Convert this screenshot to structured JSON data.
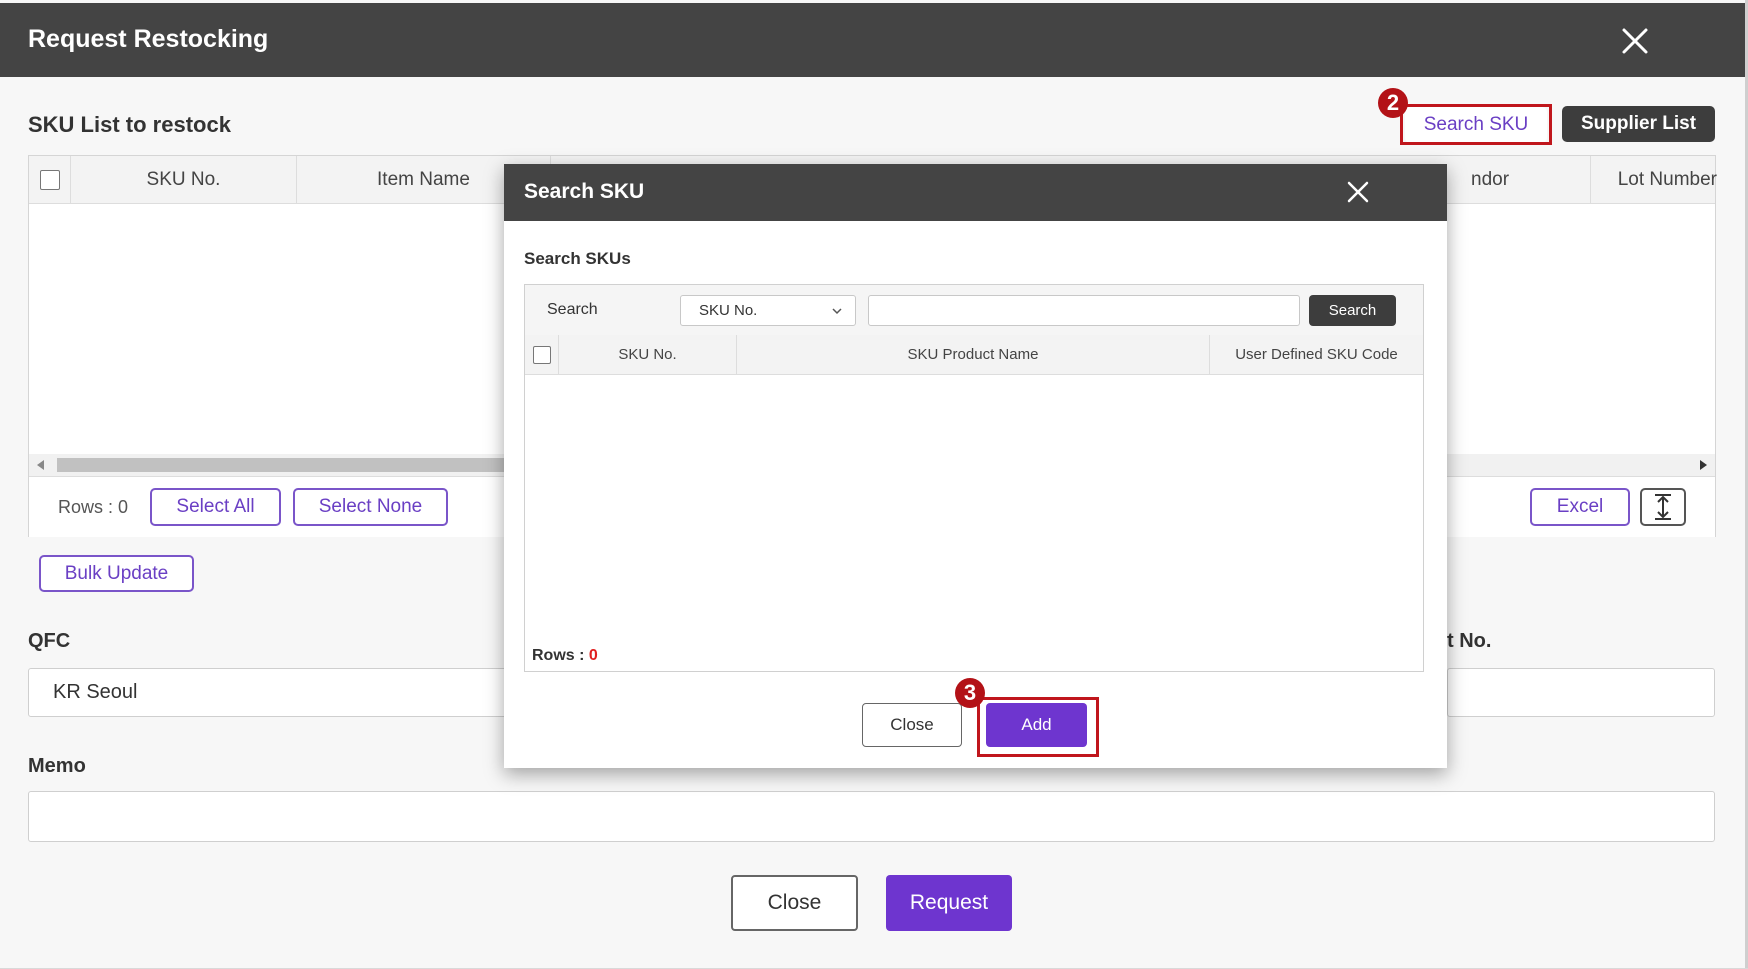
{
  "main": {
    "title": "Request Restocking",
    "section_title": "SKU List to restock",
    "toolbar": {
      "search_sku": "Search SKU",
      "supplier_list": "Supplier List"
    },
    "grid": {
      "columns": [
        "SKU No.",
        "Item Name",
        "ndor",
        "Lot Number"
      ],
      "rows_label": "Rows : 0",
      "select_all": "Select All",
      "select_none": "Select None",
      "excel": "Excel"
    },
    "bulk_update": "Bulk Update",
    "qfc_label": "QFC",
    "qfc_value": "KR Seoul",
    "partial_label": "t No.",
    "memo_label": "Memo",
    "memo_value": "",
    "close": "Close",
    "request": "Request"
  },
  "search_modal": {
    "title": "Search SKU",
    "subtitle": "Search SKUs",
    "search_label": "Search",
    "select_value": "SKU No.",
    "search_input_value": "",
    "search_button": "Search",
    "columns": [
      "SKU No.",
      "SKU Product Name",
      "User Defined SKU Code"
    ],
    "rows_label": "Rows : ",
    "rows_count": "0",
    "close": "Close",
    "add": "Add"
  },
  "annotations": {
    "step_2": "2",
    "step_3": "3"
  },
  "colors": {
    "accent": "#6e35cf",
    "header": "#444444",
    "highlight": "#c0161c"
  }
}
